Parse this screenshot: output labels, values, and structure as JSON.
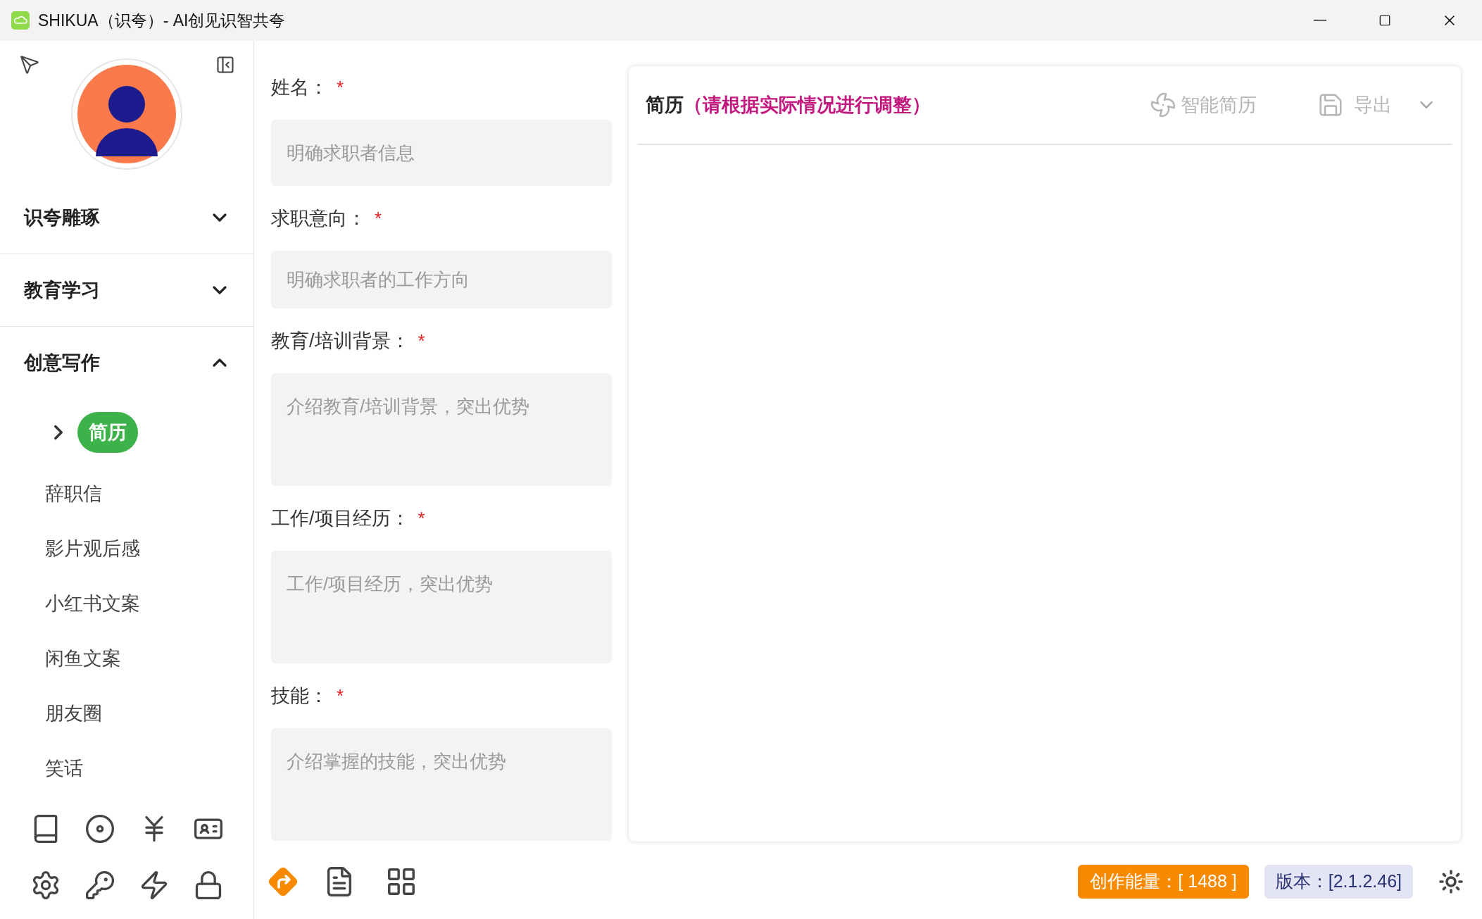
{
  "window": {
    "title": "SHIKUA（识夸）- AI创见识智共夸"
  },
  "sidebar": {
    "groups": [
      {
        "label": "识夸雕琢",
        "expanded": false
      },
      {
        "label": "教育学习",
        "expanded": false
      },
      {
        "label": "创意写作",
        "expanded": true,
        "items": [
          {
            "label": "简历",
            "selected": true
          },
          {
            "label": "辞职信",
            "selected": false
          },
          {
            "label": "影片观后感",
            "selected": false
          },
          {
            "label": "小红书文案",
            "selected": false
          },
          {
            "label": "闲鱼文案",
            "selected": false
          },
          {
            "label": "朋友圈",
            "selected": false
          },
          {
            "label": "笑话",
            "selected": false
          }
        ]
      }
    ]
  },
  "form": {
    "fields": [
      {
        "label": "姓名：",
        "required_mark": "*",
        "placeholder": "明确求职者信息",
        "kind": "input"
      },
      {
        "label": "求职意向：",
        "required_mark": "*",
        "placeholder": "明确求职者的工作方向",
        "kind": "input"
      },
      {
        "label": "教育/培训背景：",
        "required_mark": "*",
        "placeholder": "介绍教育/培训背景，突出优势",
        "kind": "textarea"
      },
      {
        "label": "工作/项目经历：",
        "required_mark": "*",
        "placeholder": "工作/项目经历，突出优势",
        "kind": "textarea"
      },
      {
        "label": "技能：",
        "required_mark": "*",
        "placeholder": "介绍掌握的技能，突出优势",
        "kind": "textarea"
      }
    ]
  },
  "panel": {
    "title": "简历",
    "hint": "（请根据实际情况进行调整）",
    "smart_button": "智能简历",
    "export_button": "导出"
  },
  "status_bar": {
    "energy": "创作能量：[ 1488 ]",
    "version": "版本：[2.1.2.46]"
  }
}
